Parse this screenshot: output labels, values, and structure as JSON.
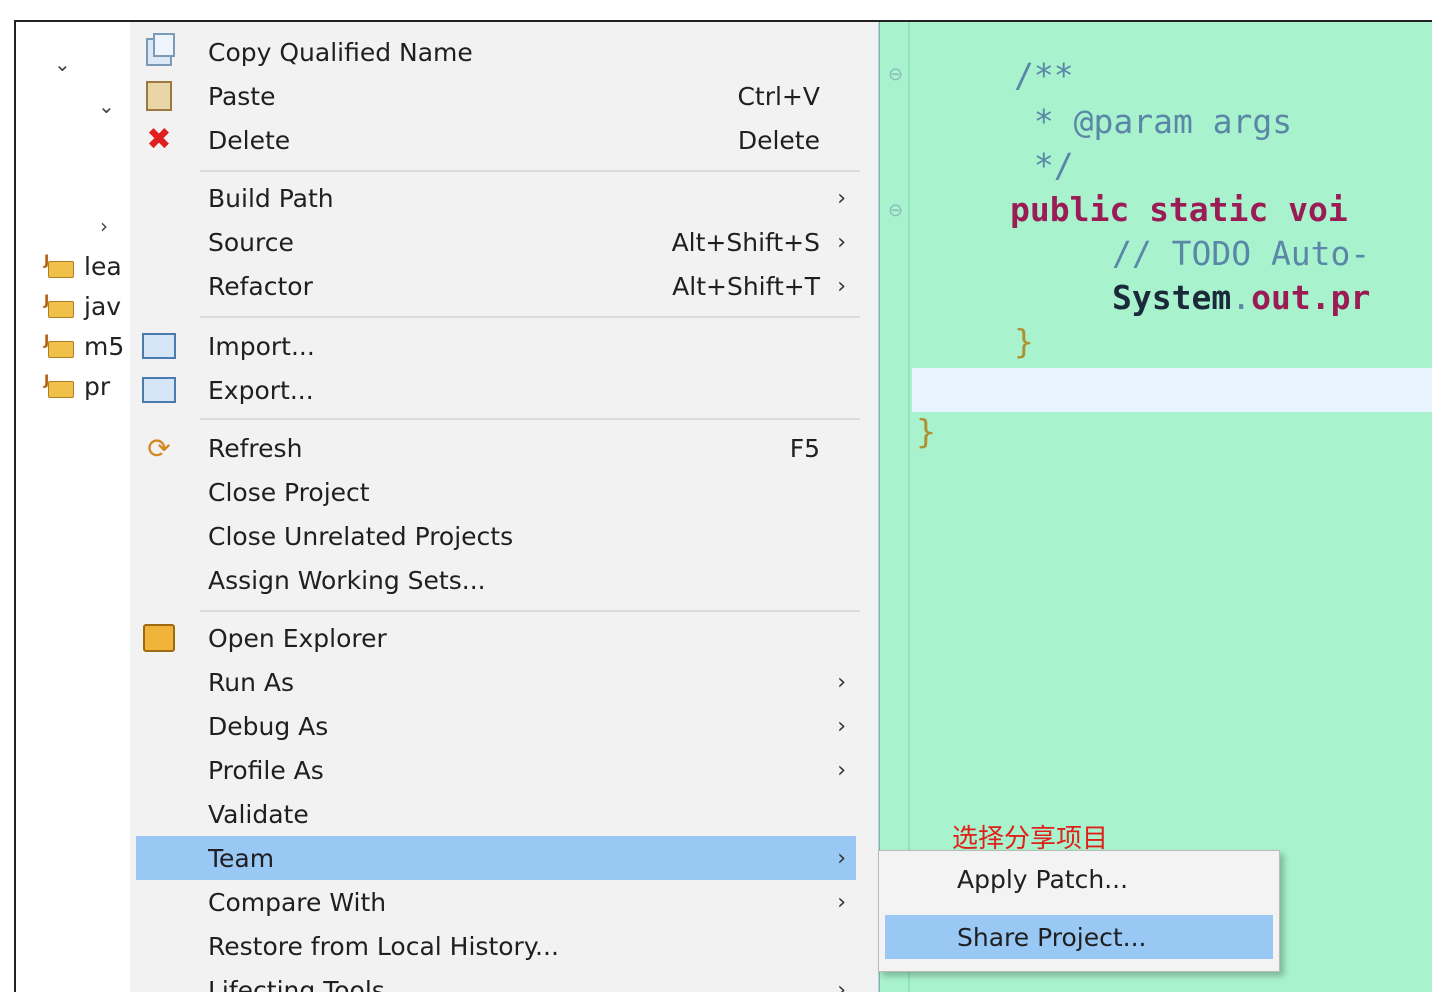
{
  "explorer": {
    "items": [
      {
        "label": "lea"
      },
      {
        "label": "jav"
      },
      {
        "label": "m5"
      },
      {
        "label": "pr"
      }
    ]
  },
  "editor": {
    "lines": {
      "c1": "/**",
      "c2": " * @param args",
      "c3": " */",
      "sig_kw": "public static voi",
      "todo": "// TODO Auto-",
      "sys_cls": "System",
      "sys_dot": ".",
      "sys_out": "out",
      "sys_rest": ".pr",
      "close1": "}",
      "close2": "}"
    }
  },
  "menu": {
    "items": [
      {
        "label": "Copy Qualified Name",
        "shortcut": "",
        "icon": "copy-icon"
      },
      {
        "label": "Paste",
        "shortcut": "Ctrl+V",
        "icon": "paste-icon"
      },
      {
        "label": "Delete",
        "shortcut": "Delete",
        "icon": "delete-icon"
      },
      {
        "label": "Build Path",
        "shortcut": "",
        "submenu": true
      },
      {
        "label": "Source",
        "shortcut": "Alt+Shift+S",
        "submenu": true
      },
      {
        "label": "Refactor",
        "shortcut": "Alt+Shift+T",
        "submenu": true
      },
      {
        "label": "Import...",
        "shortcut": "",
        "icon": "import-icon"
      },
      {
        "label": "Export...",
        "shortcut": "",
        "icon": "export-icon"
      },
      {
        "label": "Refresh",
        "shortcut": "F5",
        "icon": "refresh-icon"
      },
      {
        "label": "Close Project",
        "shortcut": ""
      },
      {
        "label": "Close Unrelated Projects",
        "shortcut": ""
      },
      {
        "label": "Assign Working Sets...",
        "shortcut": ""
      },
      {
        "label": "Open Explorer",
        "shortcut": "",
        "icon": "open-explorer-icon"
      },
      {
        "label": "Run As",
        "shortcut": "",
        "submenu": true
      },
      {
        "label": "Debug As",
        "shortcut": "",
        "submenu": true
      },
      {
        "label": "Profile As",
        "shortcut": "",
        "submenu": true
      },
      {
        "label": "Validate",
        "shortcut": ""
      },
      {
        "label": "Team",
        "shortcut": "",
        "submenu": true,
        "selected": true
      },
      {
        "label": "Compare With",
        "shortcut": "",
        "submenu": true
      },
      {
        "label": "Restore from Local History...",
        "shortcut": ""
      },
      {
        "label": "Lifecting Tools",
        "shortcut": "",
        "submenu": true
      }
    ],
    "arrow": "›"
  },
  "submenu": {
    "items": [
      {
        "label": "Apply Patch..."
      },
      {
        "label": "Share Project...",
        "selected": true
      }
    ]
  },
  "annotation": "选择分享项目",
  "colors": {
    "editor_bg": "#a8f3cd",
    "selection": "#99c8f5",
    "annotation": "#e0201a"
  }
}
